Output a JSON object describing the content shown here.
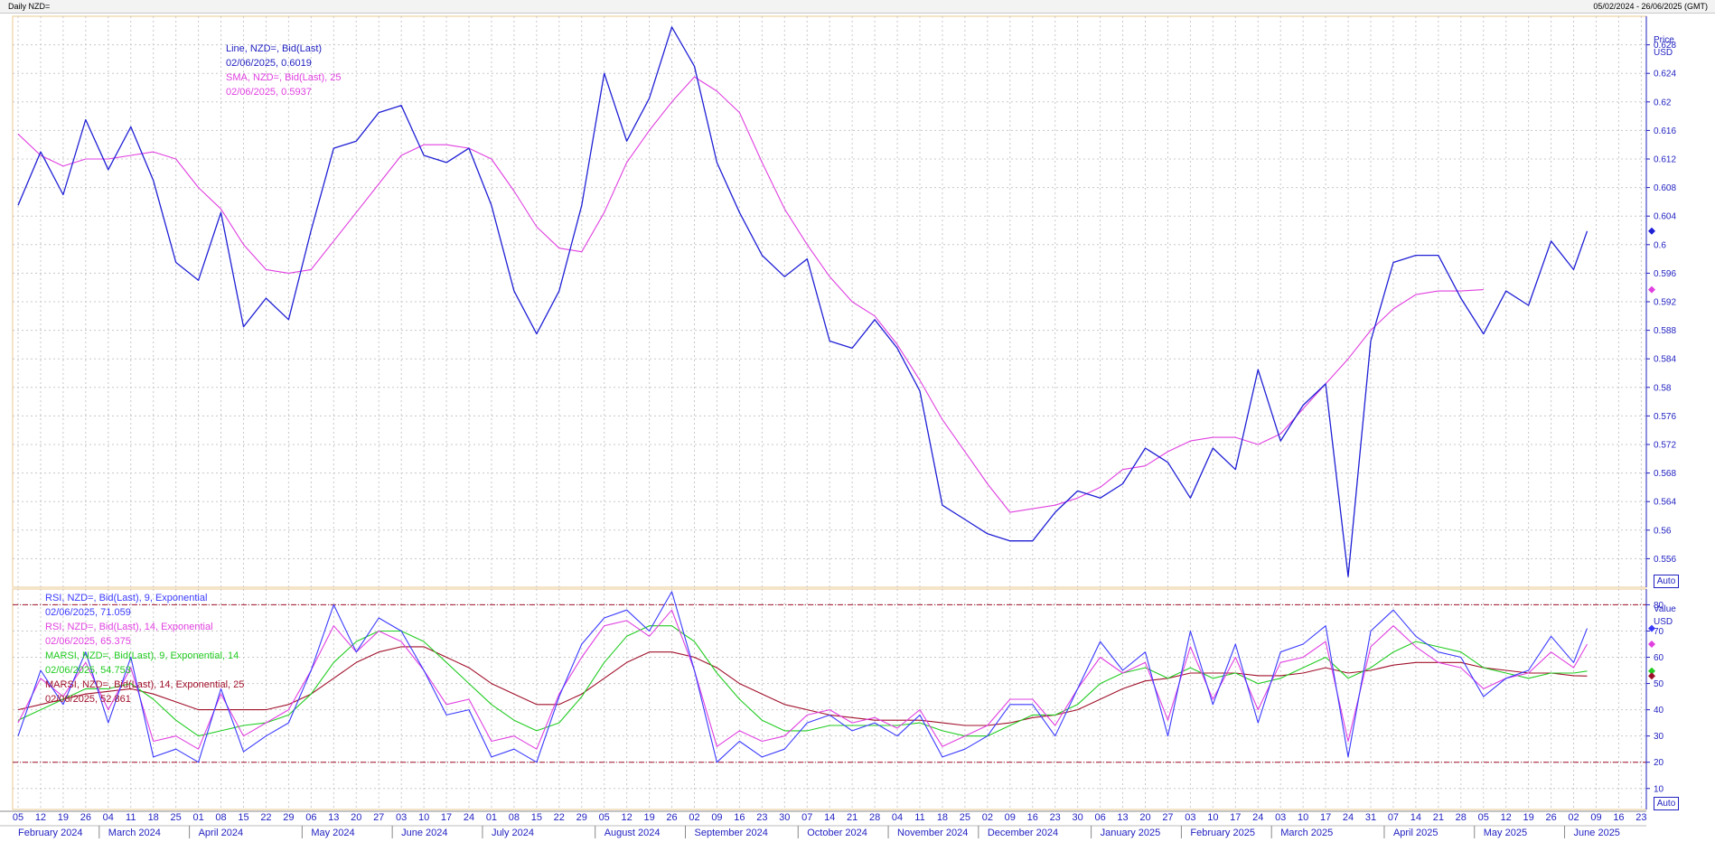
{
  "header": {
    "title": "Daily NZD=",
    "date_range": "05/02/2024 - 26/06/2025 (GMT)"
  },
  "colors": {
    "axis_blue": "#1f1fc0",
    "price_line": "#1f1fd6",
    "sma": "#e040e0",
    "rsi9": "#3a3aff",
    "rsi14": "#e040e0",
    "marsi9": "#22cc22",
    "marsi14": "#a0102a",
    "band": "#a0102a",
    "frame": "#e8c890"
  },
  "price_panel": {
    "unit_top": "Price",
    "unit_bottom": "USD",
    "auto": "Auto",
    "legend": [
      {
        "text": "Line, NZD=, Bid(Last)",
        "color": "#1f1fc0"
      },
      {
        "text": "02/06/2025, 0.6019",
        "color": "#1f1fc0"
      },
      {
        "text": "SMA, NZD=, Bid(Last),  25",
        "color": "#e040e0"
      },
      {
        "text": "02/06/2025, 0.5937",
        "color": "#e040e0"
      }
    ]
  },
  "rsi_panel": {
    "unit_top": "Value",
    "unit_bottom": "USD",
    "auto": "Auto",
    "legend": [
      {
        "text": "RSI, NZD=, Bid(Last),  9, Exponential",
        "color": "#3a3aff"
      },
      {
        "text": "02/06/2025, 71.059",
        "color": "#3a3aff"
      },
      {
        "text": "RSI, NZD=, Bid(Last),  14, Exponential",
        "color": "#e040e0"
      },
      {
        "text": "02/06/2025, 65.375",
        "color": "#e040e0"
      },
      {
        "text": "MARSI, NZD=, Bid(Last),  9, Exponential, 14",
        "color": "#22cc22"
      },
      {
        "text": "02/06/2025, 54.753",
        "color": "#22cc22"
      },
      {
        "text": "MARSI, NZD=, Bid(Last),  14, Exponential, 25",
        "color": "#a0102a"
      },
      {
        "text": "02/06/2025, 52.861",
        "color": "#a0102a"
      }
    ]
  },
  "chart_data": [
    {
      "type": "line",
      "title": "",
      "ylabel": "Price USD",
      "ylim": [
        0.552,
        0.632
      ],
      "y_ticks": [
        "0.556",
        "0.56",
        "0.564",
        "0.568",
        "0.572",
        "0.576",
        "0.58",
        "0.584",
        "0.588",
        "0.592",
        "0.596",
        "0.6",
        "0.604",
        "0.608",
        "0.612",
        "0.616",
        "0.62",
        "0.624",
        "0.628"
      ],
      "x_week_labels": [
        "05",
        "12",
        "19",
        "26",
        "04",
        "11",
        "18",
        "25",
        "01",
        "08",
        "15",
        "22",
        "29",
        "06",
        "13",
        "20",
        "27",
        "03",
        "10",
        "17",
        "24",
        "01",
        "08",
        "15",
        "22",
        "29",
        "05",
        "12",
        "19",
        "26",
        "02",
        "09",
        "16",
        "23",
        "30",
        "07",
        "14",
        "21",
        "28",
        "04",
        "11",
        "18",
        "25",
        "02",
        "09",
        "16",
        "23",
        "30",
        "06",
        "13",
        "20",
        "27",
        "03",
        "10",
        "17",
        "24",
        "03",
        "10",
        "17",
        "24",
        "31",
        "07",
        "14",
        "21",
        "28",
        "05",
        "12",
        "19",
        "26",
        "02",
        "09",
        "16",
        "23"
      ],
      "x_month_labels": [
        "February 2024",
        "March 2024",
        "April 2024",
        "May 2024",
        "June 2024",
        "July 2024",
        "August 2024",
        "September 2024",
        "October 2024",
        "November 2024",
        "December 2024",
        "January 2025",
        "February 2025",
        "March 2025",
        "April 2025",
        "May 2025",
        "June 2025"
      ],
      "series": [
        {
          "name": "Line, NZD=, Bid(Last)",
          "x_week_index": [
            0,
            1,
            2,
            3,
            4,
            5,
            6,
            7,
            8,
            9,
            10,
            11,
            12,
            13,
            14,
            15,
            16,
            17,
            18,
            19,
            20,
            21,
            22,
            23,
            24,
            25,
            26,
            27,
            28,
            29,
            30,
            31,
            32,
            33,
            34,
            35,
            36,
            37,
            38,
            39,
            40,
            41,
            42,
            43,
            44,
            45,
            46,
            47,
            48,
            49,
            50,
            51,
            52,
            53,
            54,
            55,
            56,
            57,
            58,
            59,
            60,
            61,
            62,
            63,
            64,
            65,
            66,
            67,
            68,
            69,
            69.6
          ],
          "values": [
            0.6055,
            0.613,
            0.607,
            0.6175,
            0.6105,
            0.6165,
            0.609,
            0.5975,
            0.595,
            0.6045,
            0.5885,
            0.5925,
            0.5895,
            0.602,
            0.6135,
            0.6145,
            0.6185,
            0.6195,
            0.6125,
            0.6115,
            0.6135,
            0.6055,
            0.5935,
            0.5875,
            0.5935,
            0.6055,
            0.624,
            0.6145,
            0.6205,
            0.6305,
            0.625,
            0.6115,
            0.6045,
            0.5985,
            0.5955,
            0.598,
            0.5865,
            0.5855,
            0.5895,
            0.5855,
            0.5795,
            0.5635,
            0.5615,
            0.5595,
            0.5585,
            0.5585,
            0.5625,
            0.5655,
            0.5645,
            0.5665,
            0.5715,
            0.5695,
            0.5645,
            0.5715,
            0.5685,
            0.5825,
            0.5725,
            0.5775,
            0.5805,
            0.5535,
            0.5865,
            0.5975,
            0.5985,
            0.5985,
            0.5925,
            0.5875,
            0.5935,
            0.5915,
            0.6005,
            0.5965,
            0.6019
          ]
        },
        {
          "name": "SMA, NZD=, Bid(Last),  25",
          "x_week_index": [
            0,
            1,
            2,
            3,
            4,
            5,
            6,
            7,
            8,
            9,
            10,
            11,
            12,
            13,
            14,
            15,
            16,
            17,
            18,
            19,
            20,
            21,
            22,
            23,
            24,
            25,
            26,
            27,
            28,
            29,
            30,
            31,
            32,
            33,
            34,
            35,
            36,
            37,
            38,
            39,
            40,
            41,
            42,
            43,
            44,
            45,
            46,
            47,
            48,
            49,
            50,
            51,
            52,
            53,
            54,
            55,
            56,
            57,
            58,
            59,
            60,
            61,
            62,
            63,
            64,
            65,
            66,
            67,
            68,
            69,
            69.6
          ],
          "values": [
            0.6155,
            0.6125,
            0.611,
            0.612,
            0.612,
            0.6125,
            0.613,
            0.612,
            0.608,
            0.605,
            0.6,
            0.5965,
            0.596,
            0.5965,
            0.6005,
            0.6045,
            0.6085,
            0.6125,
            0.614,
            0.614,
            0.6135,
            0.612,
            0.6075,
            0.6025,
            0.5995,
            0.599,
            0.6045,
            0.6115,
            0.616,
            0.62,
            0.6235,
            0.6215,
            0.6185,
            0.6115,
            0.605,
            0.6,
            0.5955,
            0.592,
            0.59,
            0.586,
            0.581,
            0.5755,
            0.571,
            0.5665,
            0.5625,
            0.563,
            0.5635,
            0.5645,
            0.566,
            0.5685,
            0.569,
            0.571,
            0.5725,
            0.573,
            0.573,
            0.572,
            0.5735,
            0.577,
            0.5805,
            0.584,
            0.588,
            0.591,
            0.593,
            0.5935,
            0.5935,
            0.5937
          ]
        }
      ]
    },
    {
      "type": "line",
      "title": "",
      "ylabel": "Value USD",
      "ylim": [
        2,
        86
      ],
      "y_ticks": [
        "10",
        "20",
        "30",
        "40",
        "50",
        "60",
        "70",
        "80"
      ],
      "bands": [
        20,
        80
      ],
      "series": [
        {
          "name": "RSI, NZD=, Bid(Last),  9, Exponential",
          "x_week_index": [
            0,
            1,
            2,
            3,
            4,
            5,
            6,
            7,
            8,
            9,
            10,
            11,
            12,
            13,
            14,
            15,
            16,
            17,
            18,
            19,
            20,
            21,
            22,
            23,
            24,
            25,
            26,
            27,
            28,
            29,
            30,
            31,
            32,
            33,
            34,
            35,
            36,
            37,
            38,
            39,
            40,
            41,
            42,
            43,
            44,
            45,
            46,
            47,
            48,
            49,
            50,
            51,
            52,
            53,
            54,
            55,
            56,
            57,
            58,
            59,
            60,
            61,
            62,
            63,
            64,
            65,
            66,
            67,
            68,
            69,
            69.6
          ],
          "values": [
            30,
            55,
            42,
            62,
            35,
            60,
            22,
            25,
            20,
            48,
            24,
            30,
            35,
            55,
            80,
            62,
            75,
            70,
            55,
            38,
            40,
            22,
            25,
            20,
            45,
            65,
            75,
            78,
            70,
            85,
            55,
            20,
            28,
            22,
            25,
            35,
            38,
            32,
            35,
            30,
            38,
            22,
            25,
            30,
            42,
            42,
            30,
            48,
            66,
            55,
            62,
            30,
            70,
            42,
            65,
            35,
            62,
            65,
            72,
            22,
            70,
            78,
            68,
            62,
            60,
            45,
            52,
            55,
            68,
            58,
            71
          ]
        },
        {
          "name": "RSI, NZD=, Bid(Last),  14, Exponential",
          "x_week_index": [
            0,
            1,
            2,
            3,
            4,
            5,
            6,
            7,
            8,
            9,
            10,
            11,
            12,
            13,
            14,
            15,
            16,
            17,
            18,
            19,
            20,
            21,
            22,
            23,
            24,
            25,
            26,
            27,
            28,
            29,
            30,
            31,
            32,
            33,
            34,
            35,
            36,
            37,
            38,
            39,
            40,
            41,
            42,
            43,
            44,
            45,
            46,
            47,
            48,
            49,
            50,
            51,
            52,
            53,
            54,
            55,
            56,
            57,
            58,
            59,
            60,
            61,
            62,
            63,
            64,
            65,
            66,
            67,
            68,
            69,
            69.6
          ],
          "values": [
            35,
            52,
            45,
            58,
            40,
            56,
            28,
            30,
            25,
            46,
            30,
            35,
            40,
            55,
            72,
            62,
            70,
            66,
            55,
            42,
            44,
            28,
            30,
            25,
            46,
            60,
            72,
            74,
            68,
            78,
            55,
            26,
            32,
            28,
            30,
            38,
            40,
            35,
            37,
            33,
            40,
            26,
            30,
            34,
            44,
            44,
            34,
            48,
            60,
            54,
            58,
            36,
            64,
            44,
            60,
            40,
            58,
            60,
            66,
            28,
            64,
            72,
            64,
            58,
            56,
            48,
            52,
            54,
            62,
            56,
            65
          ]
        },
        {
          "name": "MARSI, NZD=, Bid(Last),  9, Exponential, 14",
          "x_week_index": [
            0,
            1,
            2,
            3,
            4,
            5,
            6,
            7,
            8,
            9,
            10,
            11,
            12,
            13,
            14,
            15,
            16,
            17,
            18,
            19,
            20,
            21,
            22,
            23,
            24,
            25,
            26,
            27,
            28,
            29,
            30,
            31,
            32,
            33,
            34,
            35,
            36,
            37,
            38,
            39,
            40,
            41,
            42,
            43,
            44,
            45,
            46,
            47,
            48,
            49,
            50,
            51,
            52,
            53,
            54,
            55,
            56,
            57,
            58,
            59,
            60,
            61,
            62,
            63,
            64,
            65,
            66,
            67,
            68,
            69,
            69.6
          ],
          "values": [
            36,
            40,
            44,
            48,
            48,
            50,
            44,
            36,
            30,
            32,
            34,
            35,
            38,
            46,
            58,
            66,
            70,
            70,
            66,
            58,
            50,
            42,
            36,
            32,
            35,
            45,
            58,
            68,
            72,
            72,
            66,
            54,
            44,
            36,
            32,
            32,
            34,
            34,
            34,
            34,
            35,
            32,
            30,
            30,
            34,
            38,
            38,
            42,
            50,
            54,
            56,
            52,
            56,
            52,
            54,
            50,
            52,
            56,
            60,
            52,
            56,
            62,
            66,
            64,
            62,
            56,
            54,
            52,
            54,
            54,
            54.75
          ]
        },
        {
          "name": "MARSI, NZD=, Bid(Last),  14, Exponential, 25",
          "x_week_index": [
            0,
            1,
            2,
            3,
            4,
            5,
            6,
            7,
            8,
            9,
            10,
            11,
            12,
            13,
            14,
            15,
            16,
            17,
            18,
            19,
            20,
            21,
            22,
            23,
            24,
            25,
            26,
            27,
            28,
            29,
            30,
            31,
            32,
            33,
            34,
            35,
            36,
            37,
            38,
            39,
            40,
            41,
            42,
            43,
            44,
            45,
            46,
            47,
            48,
            49,
            50,
            51,
            52,
            53,
            54,
            55,
            56,
            57,
            58,
            59,
            60,
            61,
            62,
            63,
            64,
            65,
            66,
            67,
            68,
            69,
            69.6
          ],
          "values": [
            40,
            42,
            44,
            46,
            47,
            48,
            46,
            43,
            40,
            40,
            40,
            40,
            42,
            46,
            52,
            58,
            62,
            64,
            64,
            60,
            56,
            50,
            46,
            42,
            42,
            46,
            52,
            58,
            62,
            62,
            60,
            56,
            50,
            46,
            42,
            40,
            38,
            37,
            36,
            36,
            36,
            35,
            34,
            34,
            35,
            37,
            38,
            40,
            44,
            48,
            51,
            52,
            54,
            54,
            54,
            53,
            53,
            54,
            56,
            54,
            55,
            57,
            58,
            58,
            58,
            56,
            55,
            54,
            54,
            53,
            52.86
          ]
        }
      ]
    }
  ]
}
